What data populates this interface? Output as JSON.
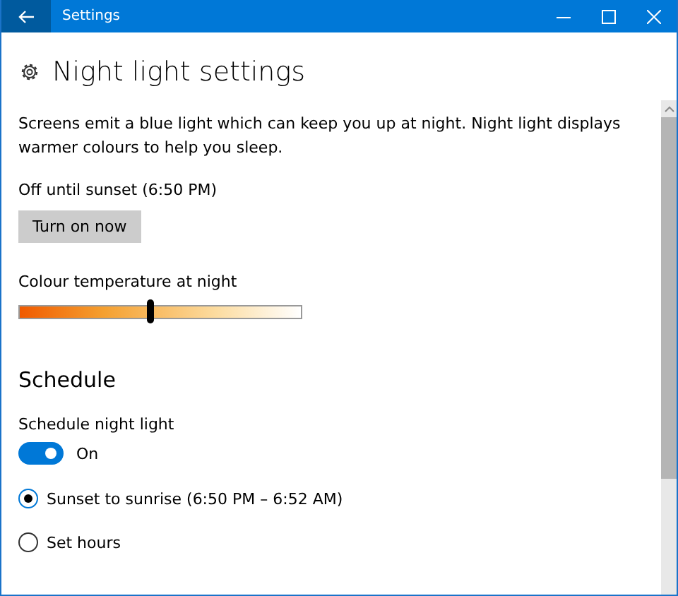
{
  "window": {
    "title": "Settings"
  },
  "page": {
    "title": "Night light settings",
    "description": "Screens emit a blue light which can keep you up at night. Night light displays warmer colours to help you sleep.",
    "status": "Off until sunset (6:50 PM)",
    "button": "Turn on now"
  },
  "temperature": {
    "label": "Colour temperature at night",
    "level": 0.46
  },
  "schedule": {
    "heading": "Schedule",
    "toggle_label": "Schedule night light",
    "toggle": {
      "on": true,
      "state_text": "On"
    },
    "options": [
      {
        "label": "Sunset to sunrise (6:50 PM – 6:52 AM)",
        "selected": true
      },
      {
        "label": "Set hours",
        "selected": false
      }
    ]
  }
}
